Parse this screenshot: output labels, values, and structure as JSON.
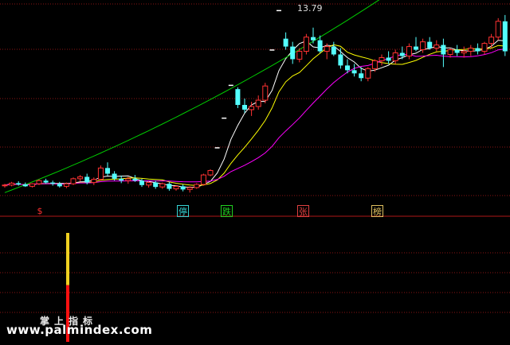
{
  "chart_data": [
    {
      "type": "candlestick",
      "peak_label": "13.79",
      "colors": {
        "up": "#ff3232",
        "down": "#54ffff",
        "grid": "#8a1414"
      },
      "candles": [
        [
          8.24,
          8.3,
          8.18,
          8.26
        ],
        [
          8.26,
          8.36,
          8.22,
          8.32
        ],
        [
          8.32,
          8.38,
          8.24,
          8.28
        ],
        [
          8.28,
          8.34,
          8.2,
          8.22
        ],
        [
          8.22,
          8.32,
          8.18,
          8.3
        ],
        [
          8.3,
          8.44,
          8.26,
          8.4
        ],
        [
          8.4,
          8.46,
          8.3,
          8.34
        ],
        [
          8.34,
          8.4,
          8.24,
          8.3
        ],
        [
          8.3,
          8.36,
          8.18,
          8.22
        ],
        [
          8.22,
          8.34,
          8.16,
          8.3
        ],
        [
          8.3,
          8.5,
          8.26,
          8.46
        ],
        [
          8.46,
          8.58,
          8.38,
          8.52
        ],
        [
          8.52,
          8.62,
          8.28,
          8.34
        ],
        [
          8.34,
          8.5,
          8.26,
          8.44
        ],
        [
          8.44,
          8.88,
          8.4,
          8.8
        ],
        [
          8.8,
          8.98,
          8.56,
          8.62
        ],
        [
          8.62,
          8.7,
          8.4,
          8.46
        ],
        [
          8.46,
          8.56,
          8.32,
          8.4
        ],
        [
          8.4,
          8.52,
          8.3,
          8.46
        ],
        [
          8.46,
          8.58,
          8.36,
          8.4
        ],
        [
          8.4,
          8.46,
          8.2,
          8.26
        ],
        [
          8.26,
          8.38,
          8.18,
          8.34
        ],
        [
          8.34,
          8.4,
          8.14,
          8.2
        ],
        [
          8.2,
          8.34,
          8.14,
          8.3
        ],
        [
          8.3,
          8.36,
          8.08,
          8.14
        ],
        [
          8.14,
          8.26,
          8.08,
          8.22
        ],
        [
          8.22,
          8.28,
          8.06,
          8.12
        ],
        [
          8.12,
          8.22,
          8.02,
          8.18
        ],
        [
          8.18,
          8.32,
          8.14,
          8.28
        ],
        [
          8.28,
          8.62,
          8.24,
          8.58
        ],
        [
          8.58,
          8.76,
          8.54,
          8.72
        ],
        [
          9.44,
          9.44,
          9.44,
          9.44
        ],
        [
          10.38,
          10.38,
          10.38,
          10.38
        ],
        [
          11.42,
          11.42,
          11.42,
          11.42
        ],
        [
          11.3,
          11.36,
          10.7,
          10.8
        ],
        [
          10.8,
          11.0,
          10.55,
          10.65
        ],
        [
          10.65,
          10.9,
          10.45,
          10.75
        ],
        [
          10.75,
          11.1,
          10.65,
          10.95
        ],
        [
          10.95,
          11.5,
          10.85,
          11.4
        ],
        [
          12.54,
          12.54,
          12.54,
          12.54
        ],
        [
          13.79,
          13.79,
          13.79,
          13.79
        ],
        [
          12.9,
          13.1,
          12.55,
          12.65
        ],
        [
          12.65,
          12.8,
          12.1,
          12.25
        ],
        [
          12.25,
          12.6,
          12.15,
          12.5
        ],
        [
          12.5,
          13.05,
          12.4,
          12.95
        ],
        [
          12.95,
          13.25,
          12.75,
          12.85
        ],
        [
          12.85,
          13.0,
          12.45,
          12.5
        ],
        [
          12.5,
          12.75,
          12.25,
          12.65
        ],
        [
          12.65,
          12.8,
          12.35,
          12.4
        ],
        [
          12.4,
          12.6,
          11.95,
          12.05
        ],
        [
          12.05,
          12.25,
          11.8,
          11.9
        ],
        [
          11.9,
          12.1,
          11.7,
          11.8
        ],
        [
          11.8,
          12.0,
          11.55,
          11.65
        ],
        [
          11.65,
          12.0,
          11.55,
          11.95
        ],
        [
          11.95,
          12.25,
          11.85,
          12.2
        ],
        [
          12.2,
          12.4,
          12.05,
          12.3
        ],
        [
          12.3,
          12.5,
          12.1,
          12.2
        ],
        [
          12.2,
          12.55,
          12.1,
          12.45
        ],
        [
          12.45,
          12.65,
          12.25,
          12.35
        ],
        [
          12.35,
          12.75,
          12.25,
          12.65
        ],
        [
          12.65,
          12.95,
          12.5,
          12.55
        ],
        [
          12.55,
          12.9,
          12.45,
          12.8
        ],
        [
          12.8,
          12.95,
          12.55,
          12.6
        ],
        [
          12.6,
          12.85,
          12.5,
          12.7
        ],
        [
          12.7,
          12.9,
          12.0,
          12.4
        ],
        [
          12.4,
          12.6,
          12.3,
          12.55
        ],
        [
          12.55,
          12.7,
          12.35,
          12.45
        ],
        [
          12.45,
          12.65,
          12.3,
          12.5
        ],
        [
          12.5,
          12.7,
          12.35,
          12.6
        ],
        [
          12.6,
          12.75,
          12.4,
          12.5
        ],
        [
          12.5,
          12.8,
          12.4,
          12.75
        ],
        [
          12.75,
          13.05,
          12.6,
          12.95
        ],
        [
          12.95,
          13.55,
          12.85,
          13.45
        ],
        [
          13.45,
          13.65,
          12.35,
          12.5
        ]
      ],
      "moving_averages": [
        {
          "period": 5,
          "color": "#ffffff"
        },
        {
          "period": 10,
          "color": "#ffff00"
        },
        {
          "period": 20,
          "color": "#ff00ff"
        },
        {
          "period": 60,
          "color": "#00cc00",
          "start": 8.02,
          "slope": 0.082
        }
      ],
      "signals": [
        {
          "type": "s",
          "index": 6,
          "text": "$",
          "color": "#ff3030"
        },
        {
          "type": "box",
          "index": 31,
          "text": "停",
          "color": "#35d4d4"
        },
        {
          "type": "box",
          "index": 37,
          "text": "跌",
          "color": "#20d020"
        },
        {
          "type": "box",
          "index": 51,
          "text": "张",
          "color": "#e04040"
        },
        {
          "type": "box",
          "index": 62,
          "text": "榜",
          "color": "#e0c060"
        }
      ]
    },
    {
      "type": "bar",
      "title": "掌上指标",
      "values": [
        0,
        0,
        0,
        0,
        0,
        0,
        0,
        0,
        0,
        0,
        1
      ],
      "split": 0.48,
      "colors": {
        "top": "#f0d020",
        "bottom": "#ff1010",
        "grid": "#8a1414"
      }
    }
  ],
  "watermark": "www.palmindex.com"
}
